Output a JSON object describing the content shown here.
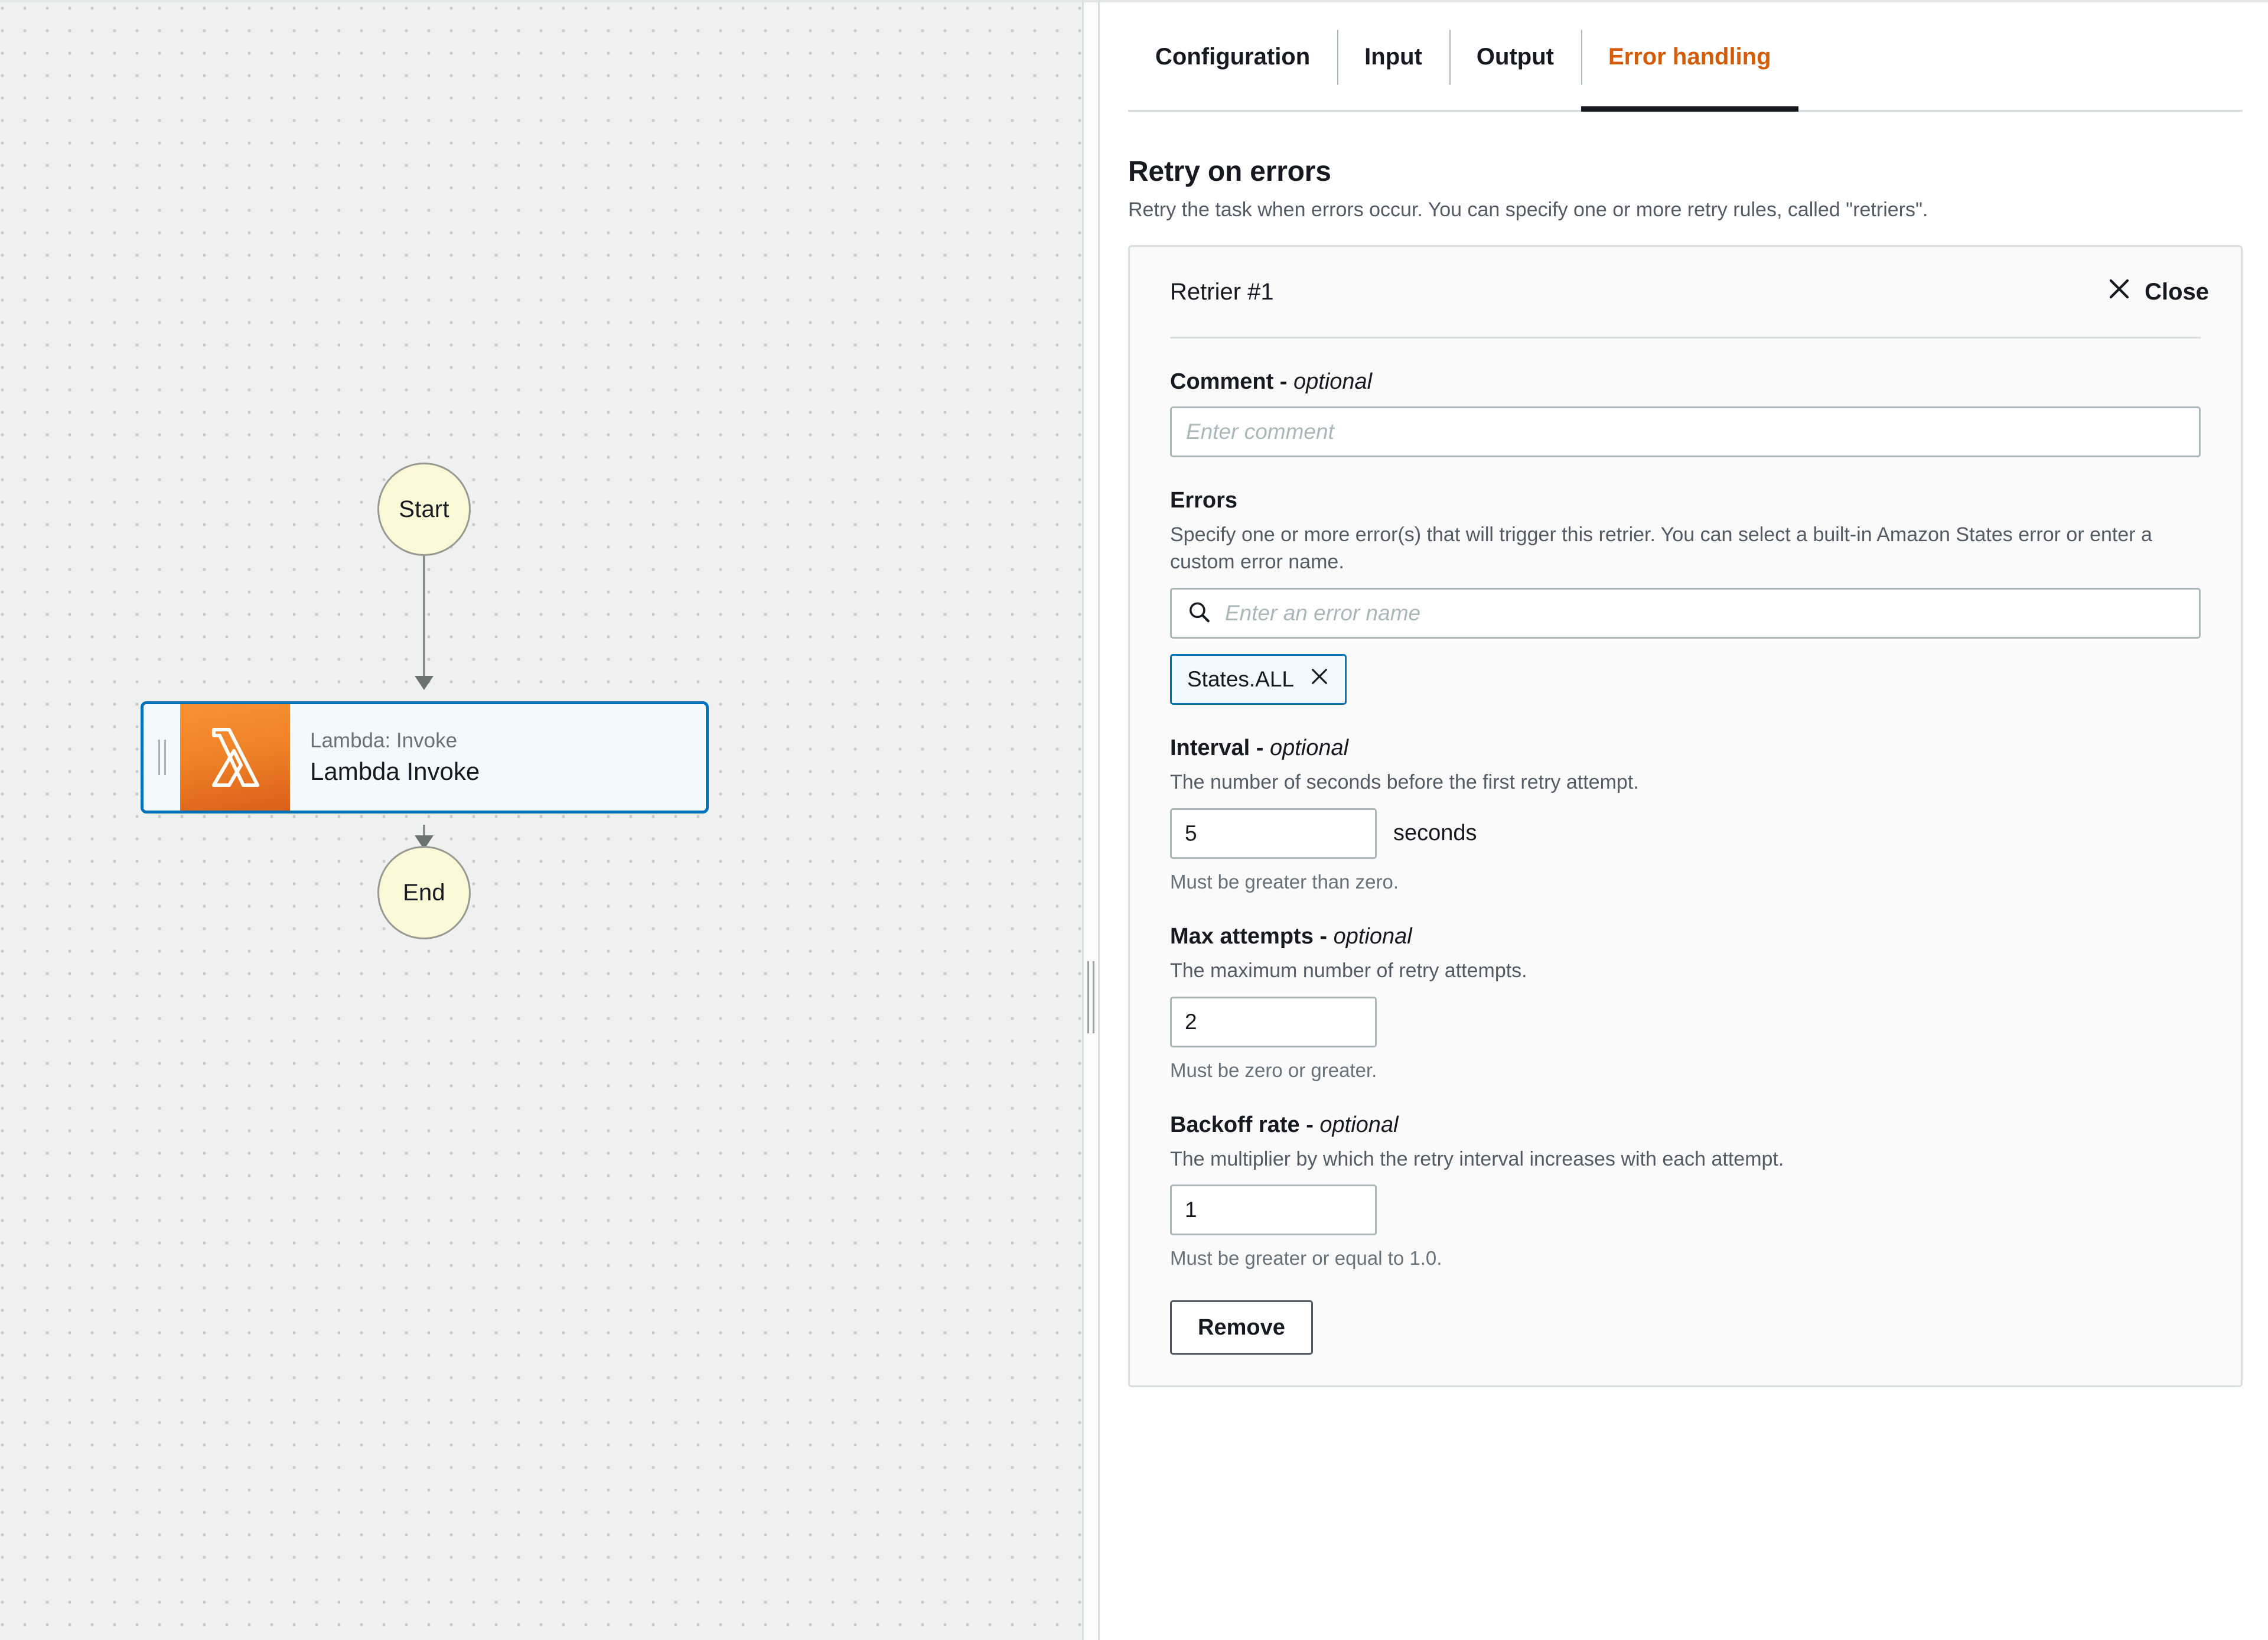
{
  "workflow": {
    "start_node": {
      "label": "Start"
    },
    "end_node": {
      "label": "End"
    },
    "task_node": {
      "type_label": "Lambda: Invoke",
      "name": "Lambda Invoke",
      "icon": "aws-lambda-icon",
      "selected_border_color": "#0073bb",
      "icon_bg_color": "#ec7211"
    },
    "canvas_bg_color": "#eff0f0"
  },
  "panel": {
    "tabs": [
      {
        "label": "Configuration",
        "active": false
      },
      {
        "label": "Input",
        "active": false
      },
      {
        "label": "Output",
        "active": false
      },
      {
        "label": "Error handling",
        "active": true
      }
    ],
    "active_tab_color": "#d45b07",
    "section": {
      "title": "Retry on errors",
      "description": "Retry the task when errors occur. You can specify one or more retry rules, called \"retriers\"."
    },
    "retrier": {
      "title": "Retrier #1",
      "close_label": "Close",
      "comment": {
        "label": "Comment - ",
        "optional": "optional",
        "value": "",
        "placeholder": "Enter comment"
      },
      "errors": {
        "label": "Errors",
        "hint": "Specify one or more error(s) that will trigger this retrier. You can select a built-in Amazon States error or enter a custom error name.",
        "search_value": "",
        "search_placeholder": "Enter an error name",
        "tokens": [
          {
            "label": "States.ALL"
          }
        ]
      },
      "interval": {
        "label": "Interval - ",
        "optional": "optional",
        "hint": "The number of seconds before the first retry attempt.",
        "value": "5",
        "unit": "seconds",
        "constraint": "Must be greater than zero."
      },
      "max_attempts": {
        "label": "Max attempts - ",
        "optional": "optional",
        "hint": "The maximum number of retry attempts.",
        "value": "2",
        "constraint": "Must be zero or greater."
      },
      "backoff_rate": {
        "label": "Backoff rate - ",
        "optional": "optional",
        "hint": "The multiplier by which the retry interval increases with each attempt.",
        "value": "1",
        "constraint": "Must be greater or equal to 1.0."
      },
      "remove_label": "Remove"
    }
  }
}
